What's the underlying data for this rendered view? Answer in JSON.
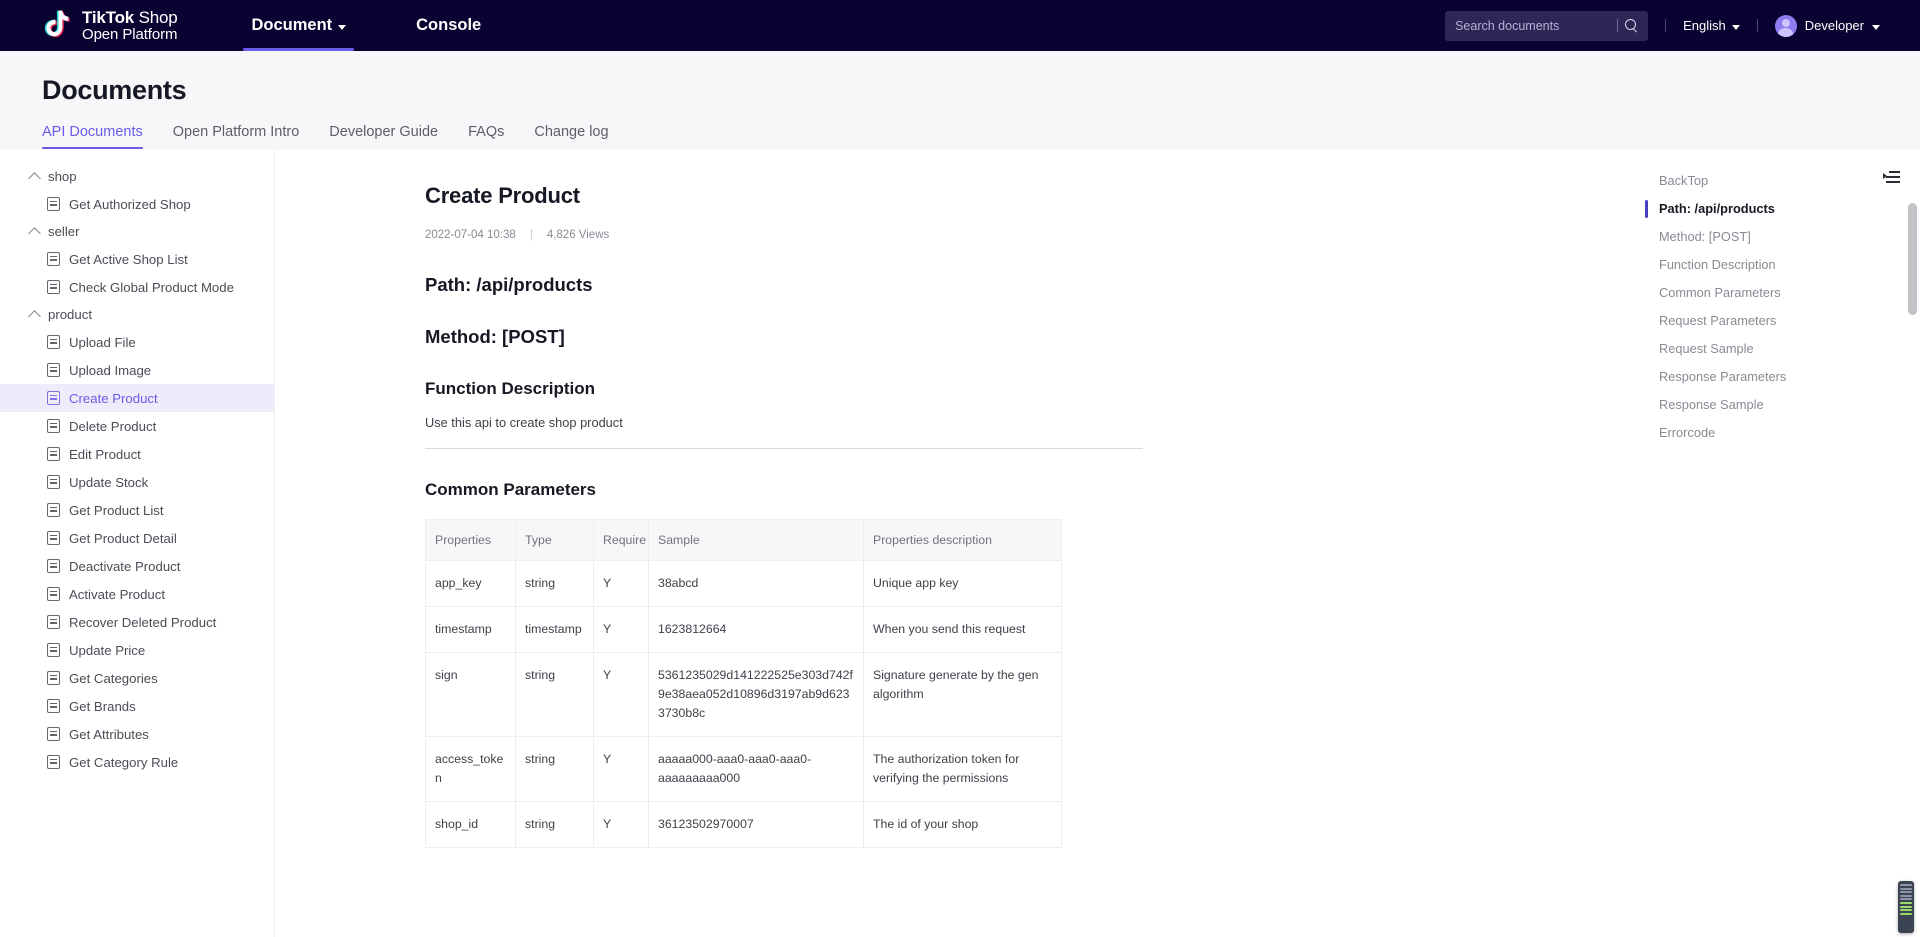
{
  "topnav": {
    "brand": {
      "line1_bold": "TikTok",
      "line1_thin": "Shop",
      "line2": "Open Platform",
      "icon": "tiktok-note-icon"
    },
    "items": [
      {
        "label": "Document",
        "active": true,
        "has_caret": true
      },
      {
        "label": "Console",
        "active": false,
        "has_caret": false
      }
    ],
    "search": {
      "placeholder": "Search documents",
      "value": "",
      "icon": "search-icon"
    },
    "language": {
      "label": "English",
      "icon": "chevron-down-icon"
    },
    "user": {
      "label": "Developer",
      "icon": "chevron-down-icon",
      "avatar": "avatar-icon"
    }
  },
  "pagehead": {
    "title": "Documents",
    "tabs": [
      {
        "label": "API Documents",
        "active": true
      },
      {
        "label": "Open Platform Intro",
        "active": false
      },
      {
        "label": "Developer Guide",
        "active": false
      },
      {
        "label": "FAQs",
        "active": false
      },
      {
        "label": "Change log",
        "active": false
      }
    ]
  },
  "sidebar": {
    "groups": [
      {
        "label": "shop",
        "items": [
          {
            "label": "Get Authorized Shop",
            "active": false
          }
        ]
      },
      {
        "label": "seller",
        "items": [
          {
            "label": "Get Active Shop List",
            "active": false
          },
          {
            "label": "Check Global Product Mode",
            "active": false
          }
        ]
      },
      {
        "label": "product",
        "items": [
          {
            "label": "Upload File",
            "active": false
          },
          {
            "label": "Upload Image",
            "active": false
          },
          {
            "label": "Create Product",
            "active": true
          },
          {
            "label": "Delete Product",
            "active": false
          },
          {
            "label": "Edit Product",
            "active": false
          },
          {
            "label": "Update Stock",
            "active": false
          },
          {
            "label": "Get Product List",
            "active": false
          },
          {
            "label": "Get Product Detail",
            "active": false
          },
          {
            "label": "Deactivate Product",
            "active": false
          },
          {
            "label": "Activate Product",
            "active": false
          },
          {
            "label": "Recover Deleted Product",
            "active": false
          },
          {
            "label": "Update Price",
            "active": false
          },
          {
            "label": "Get Categories",
            "active": false
          },
          {
            "label": "Get Brands",
            "active": false
          },
          {
            "label": "Get Attributes",
            "active": false
          },
          {
            "label": "Get Category Rule",
            "active": false
          }
        ]
      }
    ]
  },
  "article": {
    "title": "Create Product",
    "date": "2022-07-04 10:38",
    "separator": "|",
    "views": "4,826 Views",
    "path_heading": "Path: /api/products",
    "method_heading": "Method: [POST]",
    "function_description_heading": "Function Description",
    "function_description_text": "Use this api to create shop product",
    "common_parameters_heading": "Common Parameters",
    "table": {
      "columns": [
        "Properties",
        "Type",
        "Require",
        "Sample",
        "Properties description"
      ],
      "rows": [
        {
          "properties": "app_key",
          "type": "string",
          "require": "Y",
          "sample": "38abcd",
          "description": "Unique app key"
        },
        {
          "properties": "timestamp",
          "type": "timestamp",
          "require": "Y",
          "sample": "1623812664",
          "description": "When you send this request"
        },
        {
          "properties": "sign",
          "type": "string",
          "require": "Y",
          "sample": "5361235029d141222525e303d742f9e38aea052d10896d3197ab9d6233730b8c",
          "description": "Signature generate by the gen algorithm"
        },
        {
          "properties": "access_token",
          "type": "string",
          "require": "Y",
          "sample": "aaaaa000-aaa0-aaa0-aaa0-aaaaaaaaa000",
          "description": "The authorization token for verifying the permissions"
        },
        {
          "properties": "shop_id",
          "type": "string",
          "require": "Y",
          "sample": "36123502970007",
          "description": "The id of your shop"
        }
      ]
    }
  },
  "toc": {
    "back_top": "BackTop",
    "toggle_icon": "list-toggle-icon",
    "items": [
      {
        "label": "Path: /api/products",
        "active": true
      },
      {
        "label": "Method: [POST]",
        "active": false
      },
      {
        "label": "Function Description",
        "active": false
      },
      {
        "label": "Common Parameters",
        "active": false
      },
      {
        "label": "Request Parameters",
        "active": false
      },
      {
        "label": "Request Sample",
        "active": false
      },
      {
        "label": "Response Parameters",
        "active": false
      },
      {
        "label": "Response Sample",
        "active": false
      },
      {
        "label": "Errorcode",
        "active": false
      }
    ]
  },
  "colors": {
    "nav_bg": "#080330",
    "accent": "#6b5ce7",
    "toc_active_bar": "#4b3fbe",
    "page_bg": "#f7f7fa",
    "sidebar_active_bg": "#eeecfb"
  }
}
